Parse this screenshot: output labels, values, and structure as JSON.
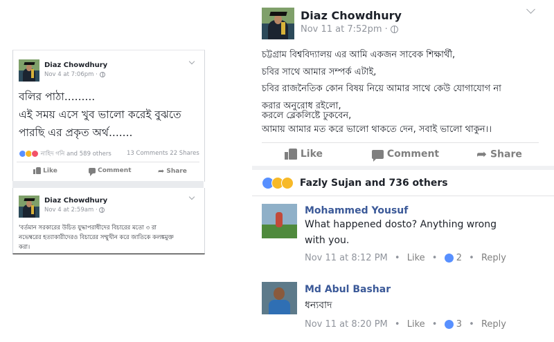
{
  "left_posts": [
    {
      "author": "Diaz Chowdhury",
      "timestamp": "Nov 4 at 7:06pm",
      "privacy_sep": "·",
      "lines": [
        "বলির পাঠা.........",
        "এই সময় এসে খুব ভালো করেই বুঝতে",
        "পারছি এর প্রকৃত অর্থ......."
      ],
      "reactions_text": "নাহিদ গনি and 589 others",
      "counts": "13 Comments 22 Shares",
      "actions": {
        "like": "Like",
        "comment": "Comment",
        "share": "Share"
      }
    },
    {
      "author": "Diaz Chowdhury",
      "timestamp": "Nov 4 at 2:59am",
      "privacy_sep": "·",
      "lines": [
        "'বর্তমান সরকারের উচিত যুদ্ধাপরাধীদের বিচারের মতো ৩ রা",
        "নভেম্বরের হত্যাকারীদেরও বিচারের সম্মুখীন করে জাতিকে কলঙ্কমুক্ত",
        "করা।"
      ]
    }
  ],
  "right_post": {
    "author": "Diaz Chowdhury",
    "timestamp": "Nov 11 at 7:52pm",
    "privacy_sep": "·",
    "lines": [
      "চট্টগ্রাম বিশ্ববিদ্যালয় এর আমি একজন সাবেক শিক্ষার্থী,",
      "চবির সাথে আমার সম্পর্ক এটাই,",
      "চবির রাজনৈতিক কোন বিষয় নিয়ে আমার সাথে কেউ যোগাযোগ না",
      "করার অনুরোধ রইলো,",
      "করলে ব্লেকলিষ্টে ঢুকবেন,",
      "আমায় আমার মত করে ভালো থাকতে দেন, সবাই ভালো থাকুন।।"
    ],
    "actions": {
      "like": "Like",
      "comment": "Comment",
      "share": "Share"
    },
    "reactions_text": "Fazly Sujan and 736 others",
    "comments": [
      {
        "author": "Mohammed Yousuf",
        "lines": [
          "What happened dosto? Anything wrong",
          "with you."
        ],
        "time": "Nov 11 at 8:12 PM",
        "like_label": "Like",
        "likes": "2",
        "reply_label": "Reply"
      },
      {
        "author": "Md Abul Bashar",
        "lines": [
          "ধন্যবাদ"
        ],
        "time": "Nov 11 at 8:20 PM",
        "like_label": "Like",
        "likes": "3",
        "reply_label": "Reply"
      }
    ]
  },
  "colors": {
    "link": "#3b5998",
    "meta": "#90949c",
    "action": "#7f7f7f",
    "like_blue": "#5890ff",
    "love_red": "#f25268",
    "haha_yellow": "#f7b928"
  },
  "icons": [
    "globe-icon",
    "chevron-down-icon",
    "like-icon",
    "comment-icon",
    "share-icon",
    "like-reaction-icon",
    "love-reaction-icon",
    "sad-reaction-icon",
    "haha-reaction-icon"
  ]
}
